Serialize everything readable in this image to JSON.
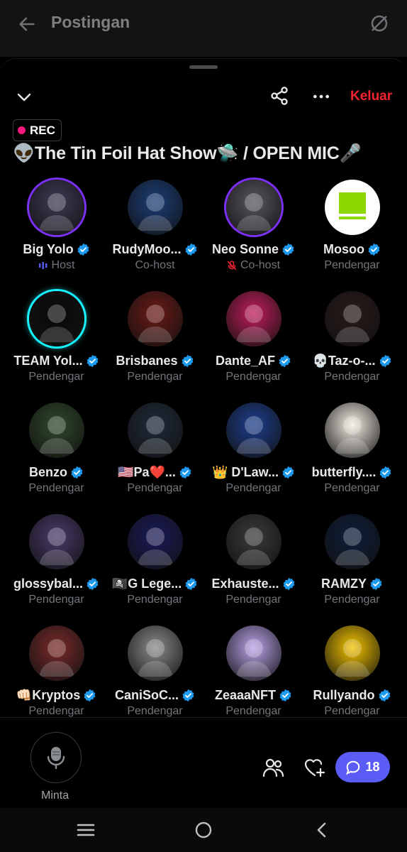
{
  "appbar": {
    "title": "Postingan"
  },
  "sheet": {
    "leave_label": "Keluar",
    "rec_label": "REC"
  },
  "space": {
    "title": "👽The Tin Foil Hat Show🛸 / OPEN MIC🎤"
  },
  "participants": [
    {
      "name": "Big Yolo",
      "role": "Host",
      "role_icon": "speaking-bars-icon",
      "verified": true,
      "avatar_color": "#3f3a55"
    },
    {
      "name": "RudyMoo...",
      "role": "Co-host",
      "verified": true,
      "avatar_color": "#1b3f7a"
    },
    {
      "name": "Neo Sonne",
      "role": "Co-host",
      "role_icon": "muted-mic-icon",
      "verified": true,
      "avatar_color": "#5a5560"
    },
    {
      "name": "Mosoo",
      "role": "Pendengar",
      "verified": true,
      "avatar_color": "#ffffff"
    },
    {
      "name": "TEAM Yol...",
      "role": "Pendengar",
      "verified": true,
      "avatar_color": "#0a0a0a"
    },
    {
      "name": "Brisbanes",
      "role": "Pendengar",
      "verified": true,
      "avatar_color": "#6b1a16"
    },
    {
      "name": "Dante_AF",
      "role": "Pendengar",
      "verified": true,
      "avatar_color": "#c21d5a"
    },
    {
      "name": "💀Taz-o-...",
      "role": "Pendengar",
      "verified": true,
      "avatar_color": "#2a1a1a"
    },
    {
      "name": "Benzo",
      "role": "Pendengar",
      "verified": true,
      "avatar_color": "#2f4a2a"
    },
    {
      "name": "🇺🇸Pa❤️...",
      "role": "Pendengar",
      "verified": true,
      "avatar_color": "#1f2a3a"
    },
    {
      "name": "👑 D'Law...",
      "role": "Pendengar",
      "verified": true,
      "avatar_color": "#1d3f8f"
    },
    {
      "name": "butterfly....",
      "role": "Pendengar",
      "verified": true,
      "avatar_color": "#f4ede4"
    },
    {
      "name": "glossybal...",
      "role": "Pendengar",
      "verified": true,
      "avatar_color": "#4a3a6a"
    },
    {
      "name": "🏴‍☠️G Lege...",
      "role": "Pendengar",
      "verified": true,
      "avatar_color": "#1a1a5a"
    },
    {
      "name": "Exhauste...",
      "role": "Pendengar",
      "verified": true,
      "avatar_color": "#3a3a3a"
    },
    {
      "name": "RAMZY",
      "role": "Pendengar",
      "verified": true,
      "avatar_color": "#0d1d3a"
    },
    {
      "name": "👊🏻Kryptos",
      "role": "Pendengar",
      "verified": true,
      "avatar_color": "#7a2a2a"
    },
    {
      "name": "CaniSoC...",
      "role": "Pendengar",
      "verified": true,
      "avatar_color": "#8a8a8a"
    },
    {
      "name": "ZeaaaNFT",
      "role": "Pendengar",
      "verified": true,
      "avatar_color": "#b9a2e8"
    },
    {
      "name": "Rullyando",
      "role": "Pendengar",
      "verified": true,
      "avatar_color": "#f2c200"
    }
  ],
  "bottom": {
    "mic_label": "Minta",
    "chat_count": "18"
  },
  "colors": {
    "accent": "#5b5cf6",
    "verified": "#1d9bf0",
    "leave": "#f4212e",
    "rec_dot": "#f91880"
  }
}
